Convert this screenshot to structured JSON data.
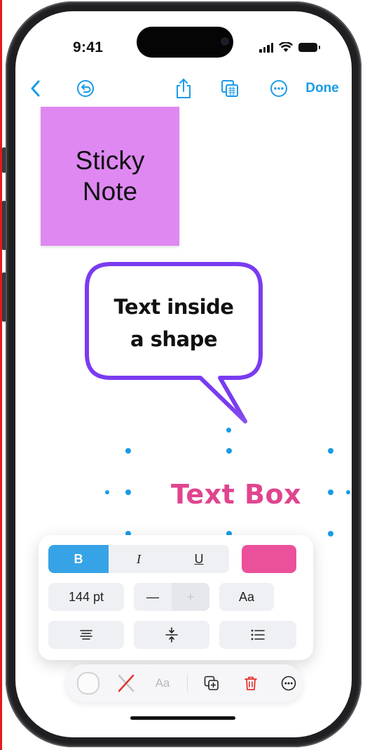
{
  "status_bar": {
    "time": "9:41"
  },
  "toolbar": {
    "back_icon": "chevron-left-icon",
    "undo_icon": "undo-icon",
    "share_icon": "share-icon",
    "copy_icon": "copy-icon",
    "more_icon": "more-icon",
    "done_label": "Done"
  },
  "canvas": {
    "sticky_note": {
      "line1": "Sticky",
      "line2": "Note",
      "color": "#df88f2"
    },
    "shape": {
      "line1": "Text inside",
      "line2": "a shape",
      "stroke_color": "#7a3bf0"
    },
    "text_box": {
      "text": "Text Box",
      "color": "#e0458f"
    }
  },
  "format_popover": {
    "bold_label": "B",
    "italic_label": "I",
    "underline_label": "U",
    "text_color": "#ea519a",
    "font_size": "144 pt",
    "decrease_label": "—",
    "increase_label": "+",
    "font_label": "Aa",
    "align_icon": "align-left-icon",
    "vertical_align_icon": "vertical-center-icon",
    "list_icon": "list-icon"
  },
  "bottom_toolbar": {
    "fill_icon": "fill-circle-icon",
    "stroke_icon": "no-stroke-icon",
    "text_label": "Aa",
    "duplicate_icon": "duplicate-icon",
    "delete_icon": "trash-icon",
    "more_icon": "more-icon"
  },
  "colors": {
    "accent": "#1a9be6",
    "destructive": "#e5322d"
  }
}
